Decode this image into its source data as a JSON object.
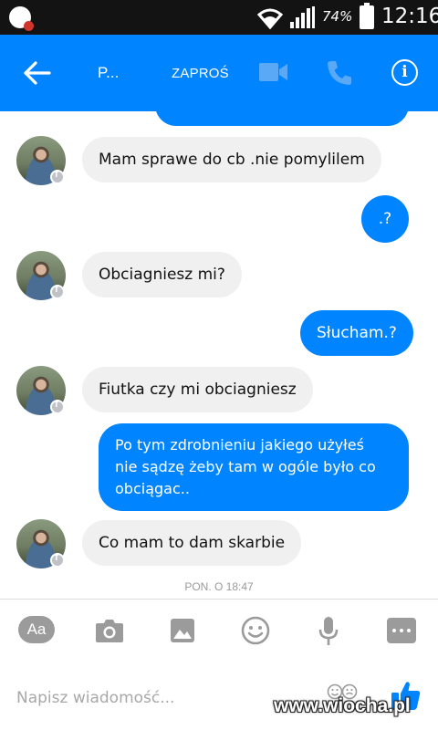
{
  "status_bar": {
    "battery": "74%",
    "time": "12:16"
  },
  "header": {
    "contact_name": "P...",
    "invite_label": "ZAPROŚ"
  },
  "messages": [
    {
      "side": "in",
      "text": "Mam sprawe do cb .nie pomylilem"
    },
    {
      "side": "out",
      "text": ".?"
    },
    {
      "side": "in",
      "text": "Obciagniesz mi?"
    },
    {
      "side": "out",
      "text": "Słucham.?"
    },
    {
      "side": "in",
      "text": "Fiutka czy mi obciagniesz"
    },
    {
      "side": "out",
      "lines": [
        "Po tym zdrobnieniu jakiego użyłeś",
        "nie sądzę żeby tam w ogóle było co",
        "obciągac.."
      ]
    },
    {
      "side": "in",
      "text": "Co mam to dam skarbie"
    }
  ],
  "timestamp": "PON. O 18:47",
  "toolbar": {
    "aa_label": "Aa"
  },
  "composer": {
    "placeholder": "Napisz wiadomość..."
  },
  "watermark": "www.wiocha.pl",
  "colors": {
    "accent": "#0084ff",
    "incoming_bubble": "#f0f0f0",
    "status_bar": "#131313"
  }
}
